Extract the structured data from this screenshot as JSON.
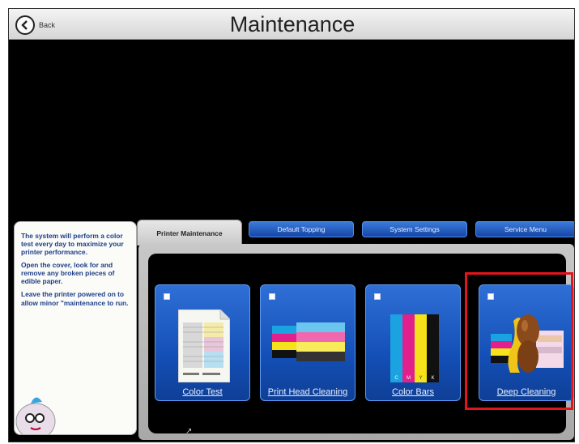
{
  "header": {
    "back_label": "Back",
    "title": "Maintenance"
  },
  "help": {
    "paragraphs": [
      "The system will perform a color test every day to maximize your printer performance.",
      "Open the cover, look for and remove any broken pieces of edible paper.",
      "Leave the printer powered on to allow minor \"maintenance to run."
    ]
  },
  "tabs": [
    {
      "label": "Printer Maintenance",
      "active": true
    },
    {
      "label": "Default Topping",
      "active": false
    },
    {
      "label": "System Settings",
      "active": false
    },
    {
      "label": "Service Menu",
      "active": false
    }
  ],
  "cards": [
    {
      "label": "Color Test",
      "icon": "color-test-page-icon"
    },
    {
      "label": "Print Head Cleaning",
      "icon": "print-head-cleaning-icon"
    },
    {
      "label": "Color Bars",
      "icon": "color-bars-icon",
      "bar_letters": [
        "C",
        "M",
        "Y",
        "K"
      ]
    },
    {
      "label": "Deep Cleaning",
      "icon": "deep-cleaning-icon"
    }
  ],
  "colors": {
    "cyan": "#1aa3e0",
    "magenta": "#e0208c",
    "yellow": "#f5e21a",
    "black": "#111111",
    "highlight": "#e3141b"
  }
}
